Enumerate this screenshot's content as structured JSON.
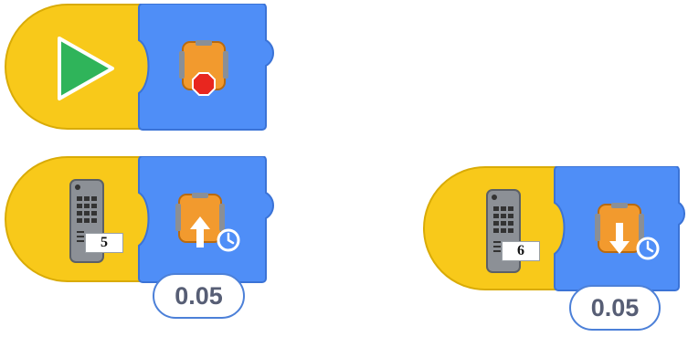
{
  "blocks": {
    "start_trigger": {
      "icon": "green-flag-play-icon",
      "action_icon": "robot-stop-icon",
      "color_yellow": "#f8c91a",
      "color_blue": "#4f8ef7"
    },
    "remote_forward": {
      "icon": "remote-control-icon",
      "key": "5",
      "action_icon": "robot-forward-timed-icon",
      "duration": "0.05"
    },
    "remote_backward": {
      "icon": "remote-control-icon",
      "key": "6",
      "action_icon": "robot-backward-timed-icon",
      "duration": "0.05"
    }
  }
}
